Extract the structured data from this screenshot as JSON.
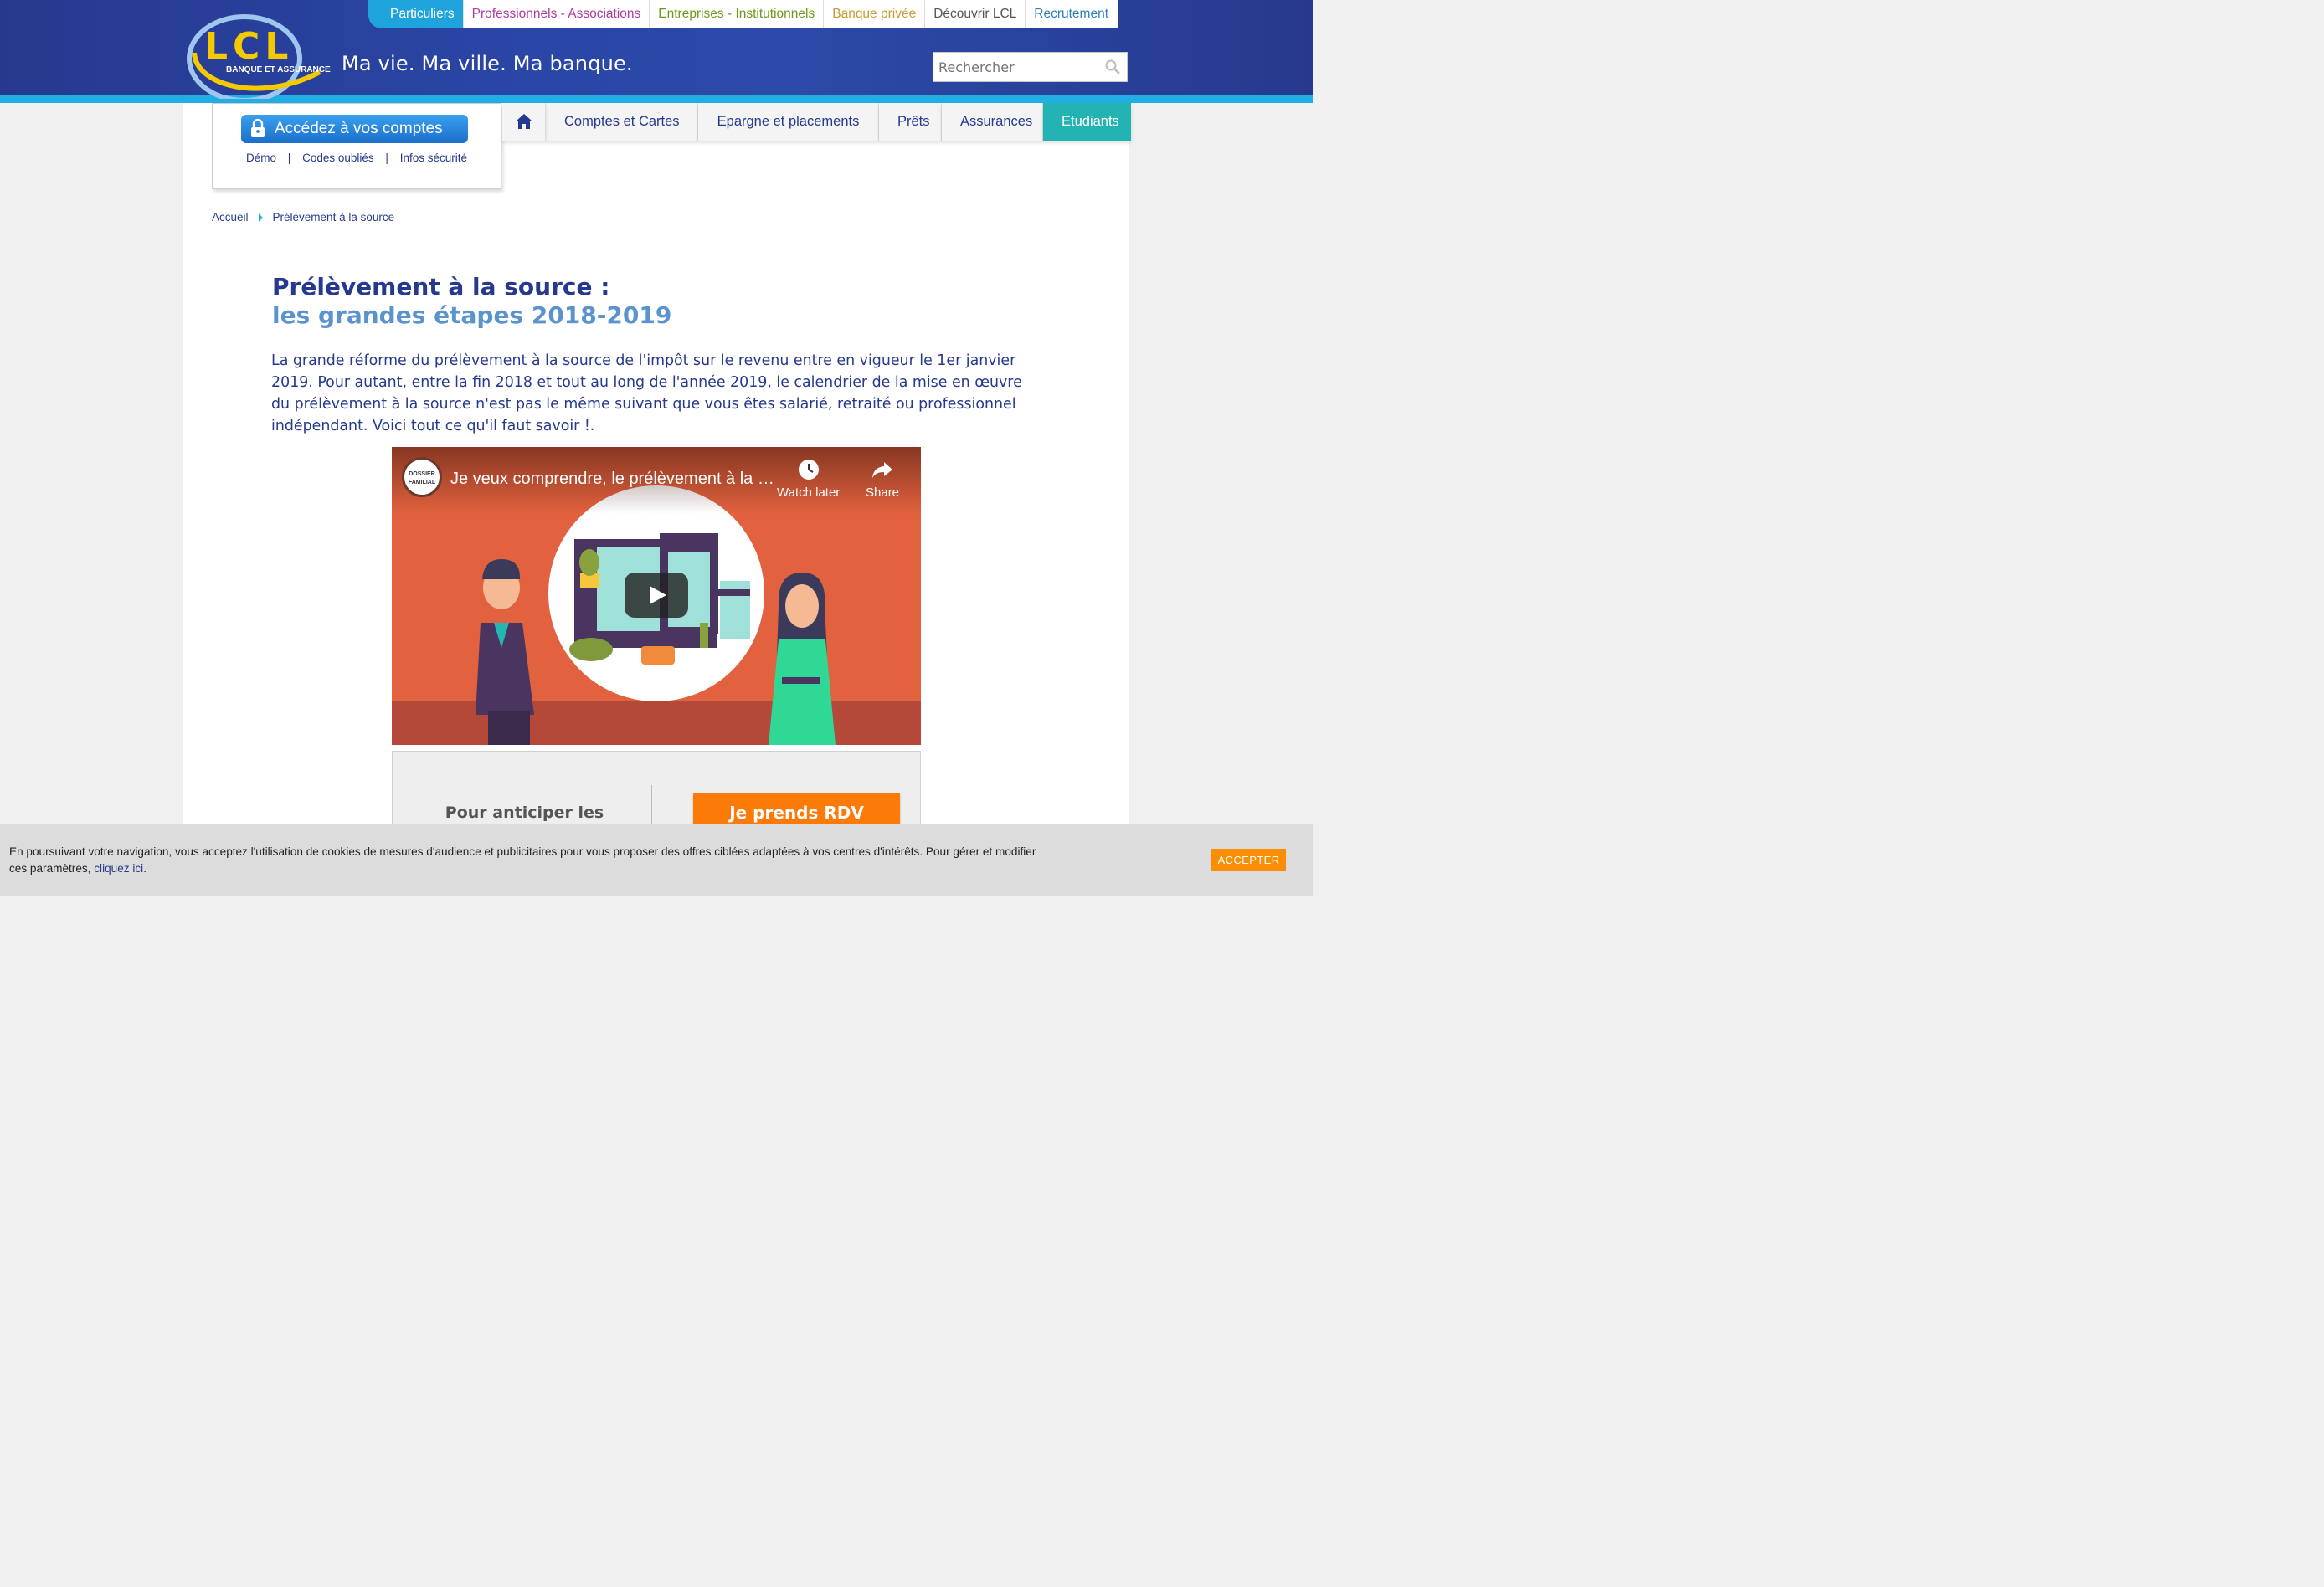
{
  "brand": {
    "logo_text": "LCL",
    "logo_subtext": "BANQUE ET ASSURANCE",
    "tagline": "Ma vie. Ma ville. Ma banque."
  },
  "top_tabs": [
    {
      "label": "Particuliers",
      "color": "#ffffff"
    },
    {
      "label": "Professionnels - Associations",
      "color": "#b03aa0"
    },
    {
      "label": "Entreprises - Institutionnels",
      "color": "#6a9a17"
    },
    {
      "label": "Banque privée",
      "color": "#c99a2e"
    },
    {
      "label": "Découvrir LCL",
      "color": "#555555"
    },
    {
      "label": "Recrutement",
      "color": "#2a82b8"
    }
  ],
  "search": {
    "placeholder": "Rechercher"
  },
  "login": {
    "button_label": "Accédez à vos comptes",
    "links": [
      "Démo",
      "Codes oubliés",
      "Infos sécurité"
    ],
    "separator": "|"
  },
  "main_nav": {
    "home_icon": "home-icon",
    "items": [
      "Comptes et Cartes",
      "Epargne et placements",
      "Prêts",
      "Assurances",
      "Etudiants"
    ]
  },
  "breadcrumb": [
    "Accueil",
    "Prélèvement à la source"
  ],
  "article": {
    "title_line1": "Prélèvement à la source :",
    "title_line2": "les grandes étapes 2018-2019",
    "intro": "La grande réforme du prélèvement à la source de l'impôt sur le revenu entre en vigueur le 1er janvier 2019. Pour autant, entre la fin 2018 et tout au long de l'année 2019, le calendrier de la mise en œuvre du prélèvement à la source n'est pas le même suivant que vous êtes salarié, retraité ou professionnel indépendant. Voici tout ce qu'il faut savoir !."
  },
  "video": {
    "channel_label": "DOSSIER FAMILIAL",
    "title": "Je veux comprendre, le prélèvement à la source",
    "watch_later": "Watch later",
    "share": "Share"
  },
  "promo": {
    "text": "Pour anticiper les changements, parlez-en",
    "button": "Je prends RDV"
  },
  "cookie": {
    "text": "En poursuivant votre navigation, vous acceptez l'utilisation de cookies de mesures d'audience et publicitaires pour vous proposer des offres ciblées adaptées à vos centres d'intérêts. Pour gérer et modifier ces paramètres, ",
    "link": "cliquez ici",
    "suffix": ".",
    "accept": "ACCEPTER"
  }
}
